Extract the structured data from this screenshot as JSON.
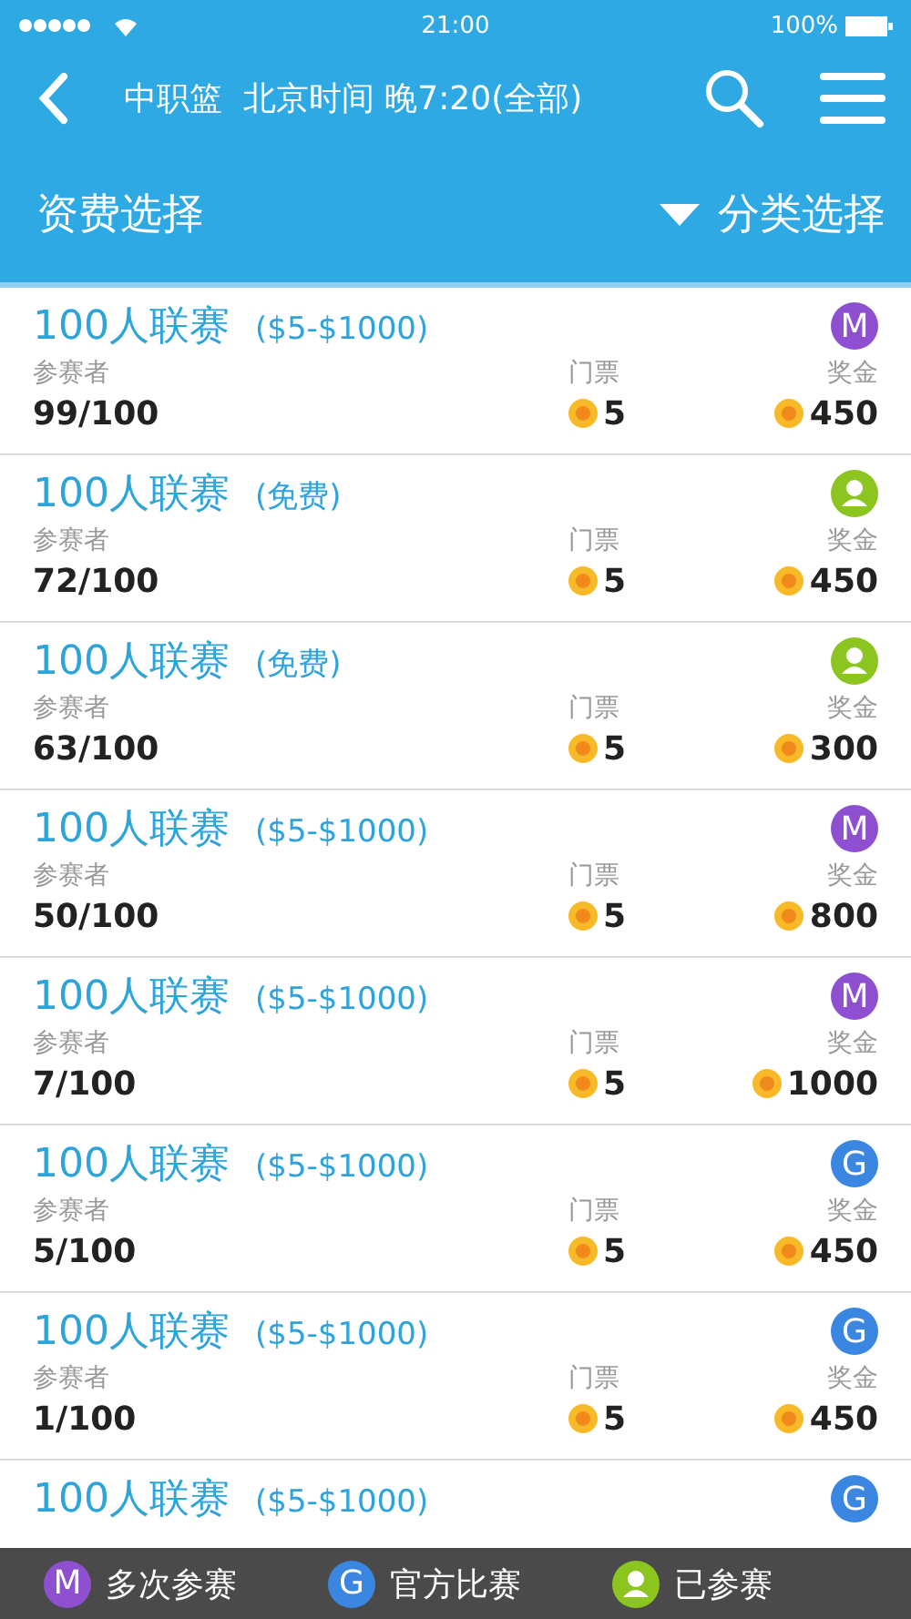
{
  "status_bar": {
    "time": "21:00",
    "battery": "100%"
  },
  "nav": {
    "title": "中职篮  北京时间 晚7:20(全部)"
  },
  "filters": {
    "left": "资费选择",
    "right": "分类选择"
  },
  "rows": [
    {
      "title": "100人联赛",
      "fee": "($5-$1000)",
      "badge": {
        "kind": "letter",
        "letter": "M",
        "color": "#8e4fd0"
      },
      "participants_label": "参赛者",
      "participants": "99/100",
      "ticket_label": "门票",
      "ticket": "5",
      "prize_label": "奖金",
      "prize": "450"
    },
    {
      "title": "100人联赛",
      "fee": "(免费)",
      "badge": {
        "kind": "person",
        "color": "#8cc420"
      },
      "participants_label": "参赛者",
      "participants": "72/100",
      "ticket_label": "门票",
      "ticket": "5",
      "prize_label": "奖金",
      "prize": "450"
    },
    {
      "title": "100人联赛",
      "fee": "(免费)",
      "badge": {
        "kind": "person",
        "color": "#8cc420"
      },
      "participants_label": "参赛者",
      "participants": "63/100",
      "ticket_label": "门票",
      "ticket": "5",
      "prize_label": "奖金",
      "prize": "300"
    },
    {
      "title": "100人联赛",
      "fee": "($5-$1000)",
      "badge": {
        "kind": "letter",
        "letter": "M",
        "color": "#8e4fd0"
      },
      "participants_label": "参赛者",
      "participants": "50/100",
      "ticket_label": "门票",
      "ticket": "5",
      "prize_label": "奖金",
      "prize": "800"
    },
    {
      "title": "100人联赛",
      "fee": "($5-$1000)",
      "badge": {
        "kind": "letter",
        "letter": "M",
        "color": "#8e4fd0"
      },
      "participants_label": "参赛者",
      "participants": "7/100",
      "ticket_label": "门票",
      "ticket": "5",
      "prize_label": "奖金",
      "prize": "1000"
    },
    {
      "title": "100人联赛",
      "fee": "($5-$1000)",
      "badge": {
        "kind": "letter",
        "letter": "G",
        "color": "#3a86e0"
      },
      "participants_label": "参赛者",
      "participants": "5/100",
      "ticket_label": "门票",
      "ticket": "5",
      "prize_label": "奖金",
      "prize": "450"
    },
    {
      "title": "100人联赛",
      "fee": "($5-$1000)",
      "badge": {
        "kind": "letter",
        "letter": "G",
        "color": "#3a86e0"
      },
      "participants_label": "参赛者",
      "participants": "1/100",
      "ticket_label": "门票",
      "ticket": "5",
      "prize_label": "奖金",
      "prize": "450"
    },
    {
      "title": "100人联赛",
      "fee": "($5-$1000)",
      "badge": {
        "kind": "letter",
        "letter": "G",
        "color": "#3a86e0"
      }
    }
  ],
  "legend": [
    {
      "badge": {
        "kind": "letter",
        "letter": "M",
        "color": "#8e4fd0"
      },
      "label": "多次参赛"
    },
    {
      "badge": {
        "kind": "letter",
        "letter": "G",
        "color": "#3a86e0"
      },
      "label": "官方比赛"
    },
    {
      "badge": {
        "kind": "person",
        "color": "#8cc420"
      },
      "label": "已参赛"
    }
  ]
}
